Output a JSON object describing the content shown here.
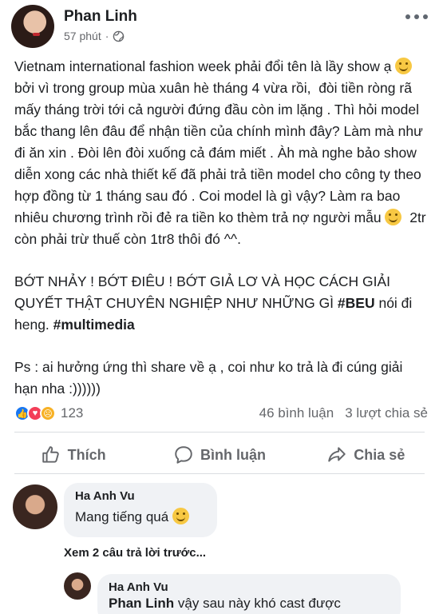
{
  "post": {
    "author": "Phan Linh",
    "time": "57 phút",
    "separator": "·",
    "paragraph1_a": "Vietnam international fashion week phải đổi tên là lầy show ạ ",
    "paragraph1_b": " bởi vì trong group mùa xuân hè tháng 4 vừa rồi,  đòi tiền ròng rã mấy tháng trời tới cả người đứng đầu còn im lặng . Thì hỏi model bắc thang lên đâu để nhận tiền của chính mình đây? Làm mà như đi ăn xin . Đòi lên đòi xuống cả đám miết . Àh mà nghe bảo show diễn xong các nhà thiết kế đã phải trả tiền model cho công ty theo hợp đồng từ 1 tháng sau đó . Coi model là gì vậy? Làm ra bao nhiêu chương trình rồi đẻ ra tiền ko thèm trả nợ người mẫu ",
    "paragraph1_c": "  2tr còn phải trừ thuế còn 1tr8 thôi đó ^^.",
    "paragraph2_a": "BỚT NHẢY ! BỚT ĐIÊU ! BỚT GIẢ LƠ VÀ HỌC CÁCH GIẢI QUYẾT THẬT CHUYÊN NGHIỆP NHƯ NHỮNG GÌ ",
    "hashtag1": "#BEU",
    "paragraph2_b": " nói đi heng. ",
    "hashtag2": "#multimedia",
    "paragraph3": "Ps : ai hưởng ứng thì share về ạ , coi như ko trả là đi cúng giải hạn nha :))))))"
  },
  "stats": {
    "reaction_count": "123",
    "comments": "46 bình luận",
    "shares": "3 lượt chia sẻ"
  },
  "actions": {
    "like": "Thích",
    "comment": "Bình luận",
    "share": "Chia sẻ"
  },
  "comments": [
    {
      "name": "Ha Anh Vu",
      "text": "Mang tiếng quá "
    },
    {
      "name": "Ha Anh Vu",
      "mention": "Phan Linh",
      "text": " vậy sau này khó cast được"
    }
  ],
  "view_more_replies": "Xem 2 câu trả lời trước...",
  "icons": {
    "privacy": "globe-icon",
    "more": "more-options-icon",
    "like": "thumbs-up-icon",
    "comment": "speech-bubble-icon",
    "share": "share-arrow-icon"
  },
  "colors": {
    "like_blue": "#1877f2",
    "love_red": "#f33e58",
    "sad_yellow": "#f7b125",
    "muted_text": "#65676b",
    "bubble_bg": "#f0f2f5"
  }
}
